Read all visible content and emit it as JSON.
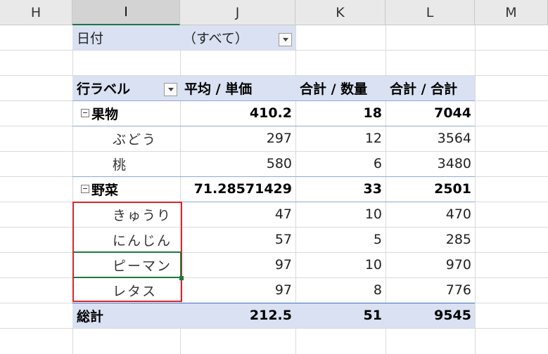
{
  "columns": [
    "H",
    "I",
    "J",
    "K",
    "L",
    "M"
  ],
  "selected_column": "I",
  "filter": {
    "label": "日付",
    "value": "（すべて）"
  },
  "header": {
    "row_label": "行ラベル",
    "col1": "平均 / 単価",
    "col2": "合計 / 数量",
    "col3": "合計 / 合計"
  },
  "groups": [
    {
      "name": "果物",
      "avg": "410.2",
      "qty": "18",
      "total": "7044",
      "items": [
        {
          "name": "ぶどう",
          "avg": "297",
          "qty": "12",
          "total": "3564"
        },
        {
          "name": "桃",
          "avg": "580",
          "qty": "6",
          "total": "3480"
        }
      ]
    },
    {
      "name": "野菜",
      "avg": "71.28571429",
      "qty": "33",
      "total": "2501",
      "items": [
        {
          "name": "きゅうり",
          "avg": "47",
          "qty": "10",
          "total": "470"
        },
        {
          "name": "にんじん",
          "avg": "57",
          "qty": "5",
          "total": "285"
        },
        {
          "name": "ピーマン",
          "avg": "97",
          "qty": "10",
          "total": "970"
        },
        {
          "name": "レタス",
          "avg": "97",
          "qty": "8",
          "total": "776"
        }
      ]
    }
  ],
  "grand_total": {
    "label": "総計",
    "avg": "212.5",
    "qty": "51",
    "total": "9545"
  },
  "colors": {
    "pivot_band": "#d9e1f2",
    "highlight_box": "#d9252b",
    "selection": "#1f7a3a"
  },
  "icons": {
    "filter_dropdown": "chevron-down-icon",
    "collapse": "minus-box-icon"
  }
}
